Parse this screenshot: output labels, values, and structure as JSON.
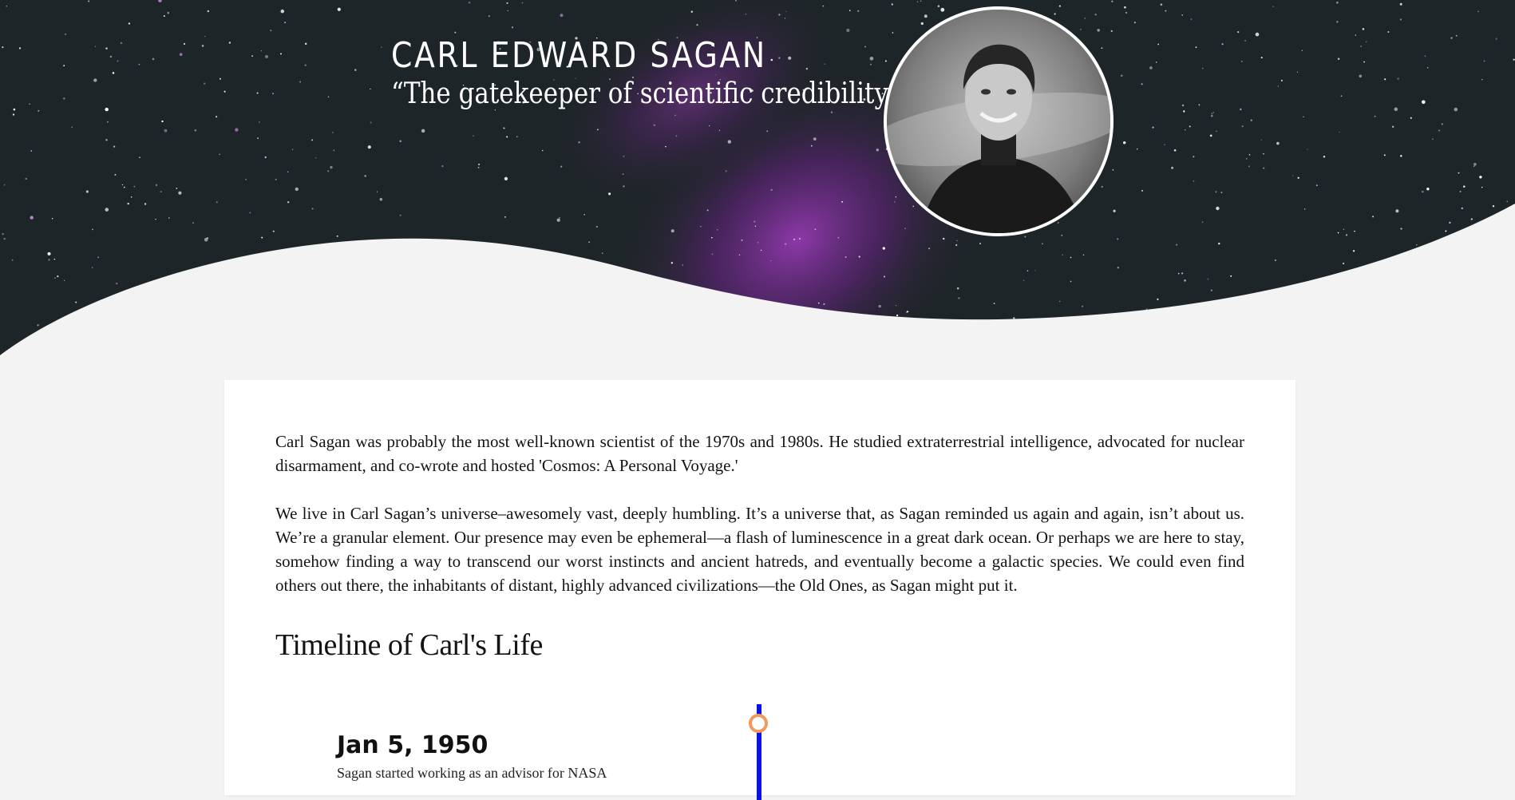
{
  "hero": {
    "title": "CARL EDWARD SAGAN",
    "quote": "“The gatekeeper of scientific credibility”",
    "colors": {
      "sky": "#1e2528",
      "nebula": "#7a2a9a",
      "page_background": "#f3f3f3"
    }
  },
  "intro": {
    "paragraph_1": "Carl Sagan was probably the most well-known scientist of the 1970s and 1980s. He studied extraterrestrial intelligence, advocated for nuclear disarmament, and co-wrote and hosted 'Cosmos: A Personal Voyage.'",
    "paragraph_2": "We live in Carl Sagan’s universe–awesomely vast, deeply humbling. It’s a universe that, as Sagan reminded us again and again, isn’t about us. We’re a granular element. Our presence may even be ephemeral—a flash of luminescence in a great dark ocean. Or perhaps we are here to stay, somehow finding a way to transcend our worst instincts and ancient hatreds, and eventually become a galactic species. We could even find others out there, the inhabitants of distant, highly advanced civilizations—the Old Ones, as Sagan might put it."
  },
  "timeline": {
    "heading": "Timeline of Carl's Life",
    "colors": {
      "line": "#0a12e6",
      "marker": "#f29a5c"
    },
    "events": [
      {
        "date": "Jan 5, 1950",
        "text": "Sagan started working as an advisor for NASA"
      }
    ]
  }
}
